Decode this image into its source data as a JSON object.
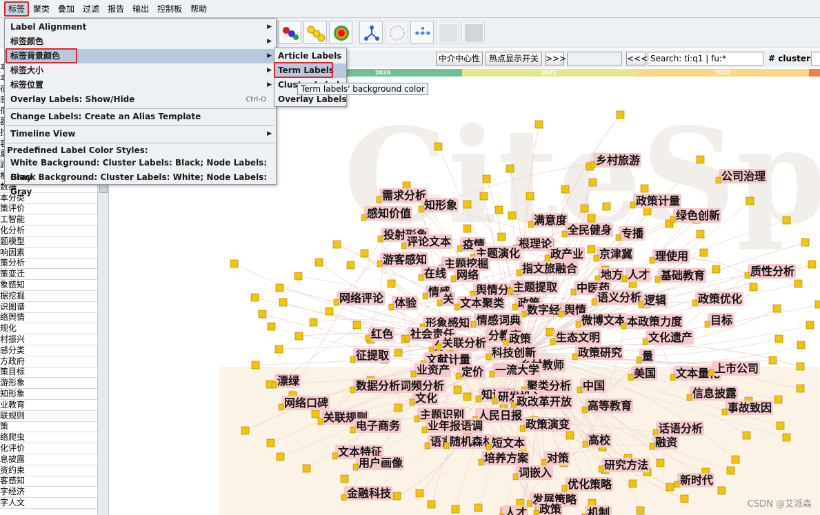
{
  "menubar": {
    "items": [
      "标签",
      "聚类",
      "叠加",
      "过滤",
      "报告",
      "输出",
      "控制板",
      "帮助"
    ],
    "active_index": 0
  },
  "dropdown": {
    "items": [
      {
        "label": "Label Alignment",
        "submenu": true
      },
      {
        "label": "标签颜色",
        "submenu": true
      },
      {
        "label": "标签背景颜色",
        "submenu": true,
        "highlighted": true
      },
      {
        "label": "标签大小",
        "submenu": true
      },
      {
        "label": "标签位置",
        "submenu": true
      },
      {
        "label": "Overlay Labels: Show/Hide",
        "shortcut": "Ctrl-O"
      }
    ],
    "change_labels": "Change Labels: Create an Alias Template",
    "timeline_view": "Timeline View",
    "predefined_header": "Predefined Label Color Styles:",
    "predefined": [
      "White Background: Cluster Labels: Black; Node Labels: Gray",
      "Black Background: Cluster Labels: White; Node Labels: Gray"
    ]
  },
  "submenu": {
    "items": [
      "Article Labels",
      "Term Labels",
      "Cluster Labels",
      "Overlay Labels"
    ],
    "highlighted_index": 1
  },
  "tooltip": "Term labels' background color",
  "toolrow": {
    "btn_centrality": "中介中心性",
    "btn_hotspot": "热点显示开关",
    "btn_next": ">>>",
    "btn_prev": "<<<",
    "search_value": "Search: ti:q1 | fu:*",
    "clusters_label": "# clusters"
  },
  "timeline": {
    "segments": [
      {
        "label": "2020",
        "color": "#6fbf94"
      },
      {
        "label": "2021",
        "color": "#e3e98a"
      },
      {
        "label": "2022",
        "color": "#f9d784"
      },
      {
        "label": "",
        "color": "#ef7f4c"
      }
    ]
  },
  "left_list": [
    "本",
    "本",
    "宿",
    "感",
    "宿",
    "器",
    "找",
    "容",
    "夏",
    "路",
    "根",
    "数据",
    "本分类",
    "策评价",
    "工智能",
    "化分析",
    "题模型",
    "响因素",
    "策分析",
    "策变迁",
    "象感知",
    "据挖掘",
    "识图谱",
    "络舆情",
    "规化",
    "村振兴",
    "感分类",
    "方政府",
    "策目标",
    "游形象",
    "知形象",
    "业教育",
    "联规则",
    "策",
    "络爬虫",
    "化评价",
    "息披露",
    "资约束",
    "客感知",
    "字经济",
    "字人文"
  ],
  "graph_labels": [
    "乡村旅游",
    "公司治理",
    "需求分析",
    "知形象",
    "政策计量",
    "感知价值",
    "绿色创新",
    "满意度",
    "全民健身",
    "专播",
    "投射形象",
    "评论文本",
    "疫情",
    "根理论",
    "游客感知",
    "主题演化",
    "政产业",
    "京津冀",
    "理使用",
    "主题挖掘",
    "指文旅融合",
    "地方",
    "人才",
    "基础教育",
    "质性分析",
    "在线",
    "网络",
    "舆情分析",
    "主题提取",
    "中医药",
    "网络评论",
    "体验",
    "情感",
    "政策",
    "语义分析",
    "逻辑",
    "政策优化",
    "关",
    "文本聚类",
    "数字经济",
    "舆情",
    "微博文本",
    "本政策力度",
    "目标",
    "形象感知",
    "情感词典",
    "红色",
    "社会责任",
    "分词",
    "旅游",
    "分教育",
    "政策",
    "生态文明",
    "文化遗产",
    "征提取",
    "关联分析",
    "科技创新",
    "政策研究",
    "量",
    "文献计量",
    "乡村教师",
    "美国",
    "文本量化",
    "上市公司",
    "漂绿",
    "业资产",
    "定价",
    "一流大学",
    "词频分析",
    "聚类分析",
    "中国",
    "信息披露",
    "数据分析",
    "文化",
    "知识图",
    "研发投入",
    "网络口碑",
    "政改革开放",
    "高等教育",
    "事故致因",
    "关联规则",
    "主题识别",
    "人民日报",
    "电子商务",
    "业年报语调",
    "政策演变",
    "话语分析",
    "高校",
    "融资",
    "语言",
    "随机森林",
    "短文本",
    "文本特征",
    "培养方案",
    "对策",
    "用户画像",
    "研究方法",
    "词嵌入",
    "优化策略",
    "新时代",
    "金融科技",
    "发展策略",
    "人才",
    "政策",
    "机制"
  ],
  "watermark": "CSDN @艾派森",
  "colors": {
    "menu_highlight": "#b8c9de",
    "red_box": "#e0262a",
    "node": "#f5c400",
    "label_bg": "#f6c9cc"
  }
}
